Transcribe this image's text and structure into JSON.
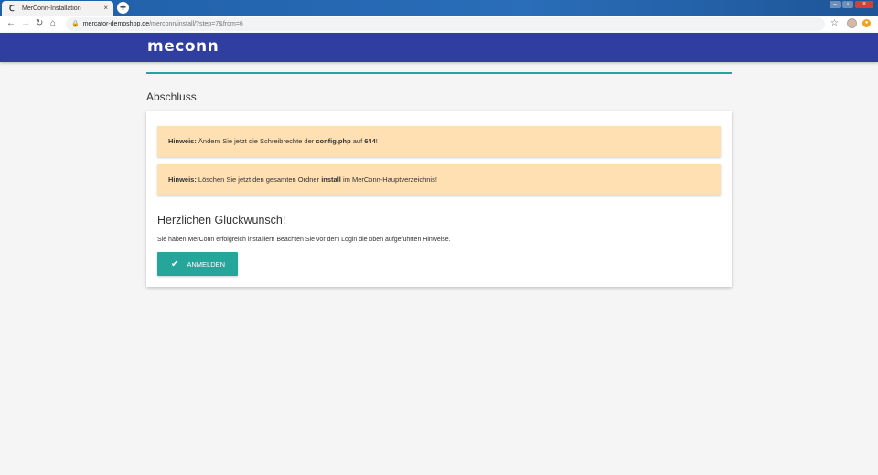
{
  "browser": {
    "tab_title": "MerConn-Installation",
    "tab_close": "×",
    "new_tab": "+",
    "url_domain": "mercator-demoshop.de",
    "url_path": "/merconn/install/?step=7&from=6"
  },
  "app": {
    "logo": "meconn"
  },
  "page": {
    "section_title": "Abschluss",
    "alerts": [
      {
        "label": "Hinweis:",
        "text1": " Ändern Sie jetzt die Schreibrechte der ",
        "strong1": "config.php",
        "text2": " auf ",
        "strong2": "644",
        "text3": "!"
      },
      {
        "label": "Hinweis:",
        "text1": " Löschen Sie jetzt den gesamten Ordner ",
        "strong1": "install",
        "text2": " im MerConn-Hauptverzeichnis!"
      }
    ],
    "congrats_heading": "Herzlichen Glückwunsch!",
    "info_text": "Sie haben MerConn erfolgreich installiert! Beachten Sie vor dem Login die oben aufgeführten Hinweise.",
    "login_button": "ANMELDEN"
  },
  "colors": {
    "header": "#303f9f",
    "accent": "#26a69a",
    "alert_bg": "#ffe0b2"
  }
}
